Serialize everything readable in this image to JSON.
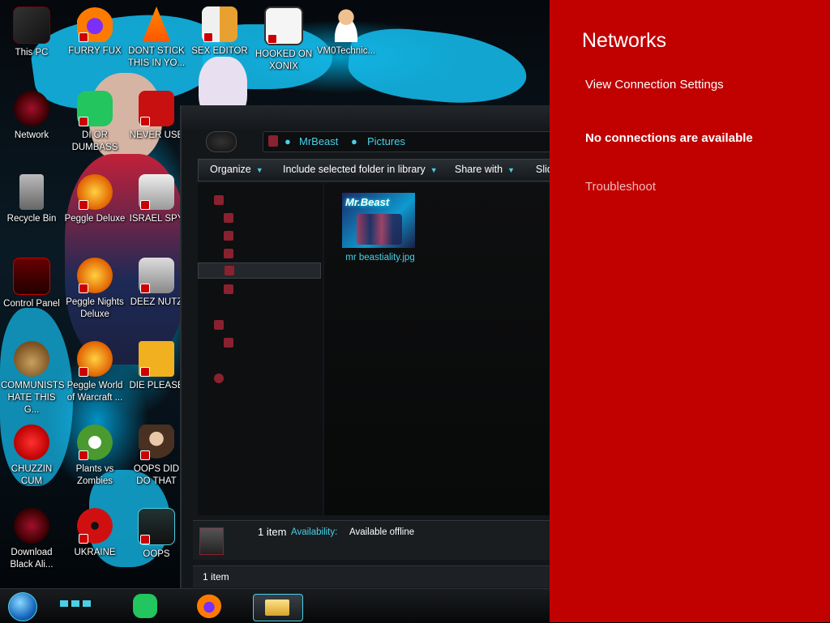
{
  "desktop": {
    "icons": [
      {
        "label": "This PC"
      },
      {
        "label": "FURRY FUX"
      },
      {
        "label": "DONT STICK THIS IN YO..."
      },
      {
        "label": "SEX EDITOR"
      },
      {
        "label": "HOOKED ON XONIX"
      },
      {
        "label": "VM0Technic..."
      },
      {
        "label": "Network"
      },
      {
        "label": "DI OR DUMBASS"
      },
      {
        "label": "NEVER USE"
      },
      {
        "label": "Recycle Bin"
      },
      {
        "label": "Peggle Deluxe"
      },
      {
        "label": "ISRAEL SPY"
      },
      {
        "label": "Control Panel"
      },
      {
        "label": "Peggle Nights Deluxe"
      },
      {
        "label": "DEEZ NUTZ"
      },
      {
        "label": "COMMUNISTS HATE THIS G..."
      },
      {
        "label": "Peggle World of Warcraft ..."
      },
      {
        "label": "DIE PLEASE"
      },
      {
        "label": "CHUZZIN CUM"
      },
      {
        "label": "Plants vs Zombies"
      },
      {
        "label": "OOPS DID DO THAT"
      },
      {
        "label": "Download Black Ali..."
      },
      {
        "label": "UKRAINE"
      },
      {
        "label": "OOPS"
      }
    ]
  },
  "explorer": {
    "breadcrumb": [
      "MrBeast",
      "Pictures"
    ],
    "commands": {
      "organize": "Organize",
      "include": "Include selected folder in library",
      "share": "Share with",
      "slideshow": "Slid"
    },
    "file": {
      "name": "mr beastiality.jpg"
    },
    "details": {
      "count": "1 item",
      "availability_label": "Availability:",
      "availability_value": "Available offline"
    },
    "status": "1 item"
  },
  "flyout": {
    "title": "Networks",
    "settings_link": "View Connection Settings",
    "status": "No connections are available",
    "troubleshoot": "Troubleshoot"
  },
  "colors": {
    "flyout_bg": "#c10000",
    "accent_cyan": "#49d0e6"
  }
}
